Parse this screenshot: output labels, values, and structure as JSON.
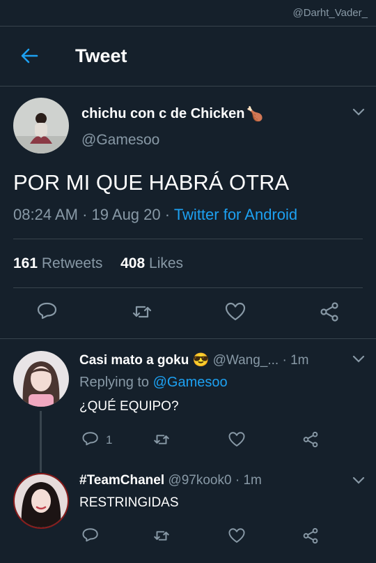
{
  "watermark": "@Darht_Vader_",
  "header": {
    "title": "Tweet"
  },
  "tweet": {
    "author_name": "chichu con c de Chicken",
    "author_emoji": "🍗",
    "handle": "@Gamesoo",
    "text": "POR MI QUE HABRÁ OTRA",
    "time": "08:24 AM",
    "date": "19 Aug 20",
    "source": "Twitter for Android",
    "retweets": "161",
    "retweets_label": "Retweets",
    "likes": "408",
    "likes_label": "Likes"
  },
  "replies": [
    {
      "name": "Casi mato a goku",
      "emoji": "😎",
      "handle": "@Wang_...",
      "time": "1m",
      "replying_label": "Replying to",
      "replying_to": "@Gamesoo",
      "text": "¿QUÉ EQUIPO?",
      "reply_count": "1"
    },
    {
      "name": "#TeamChanel",
      "handle": "@97kook0",
      "time": "1m",
      "text": "RESTRINGIDAS"
    }
  ],
  "icons": [
    "back-arrow-icon",
    "chevron-down-icon",
    "reply-icon",
    "retweet-icon",
    "like-icon",
    "share-icon"
  ],
  "colors": {
    "background": "#15202b",
    "accent": "#1da1f2",
    "muted": "#8899a6",
    "divider": "#38444d"
  }
}
